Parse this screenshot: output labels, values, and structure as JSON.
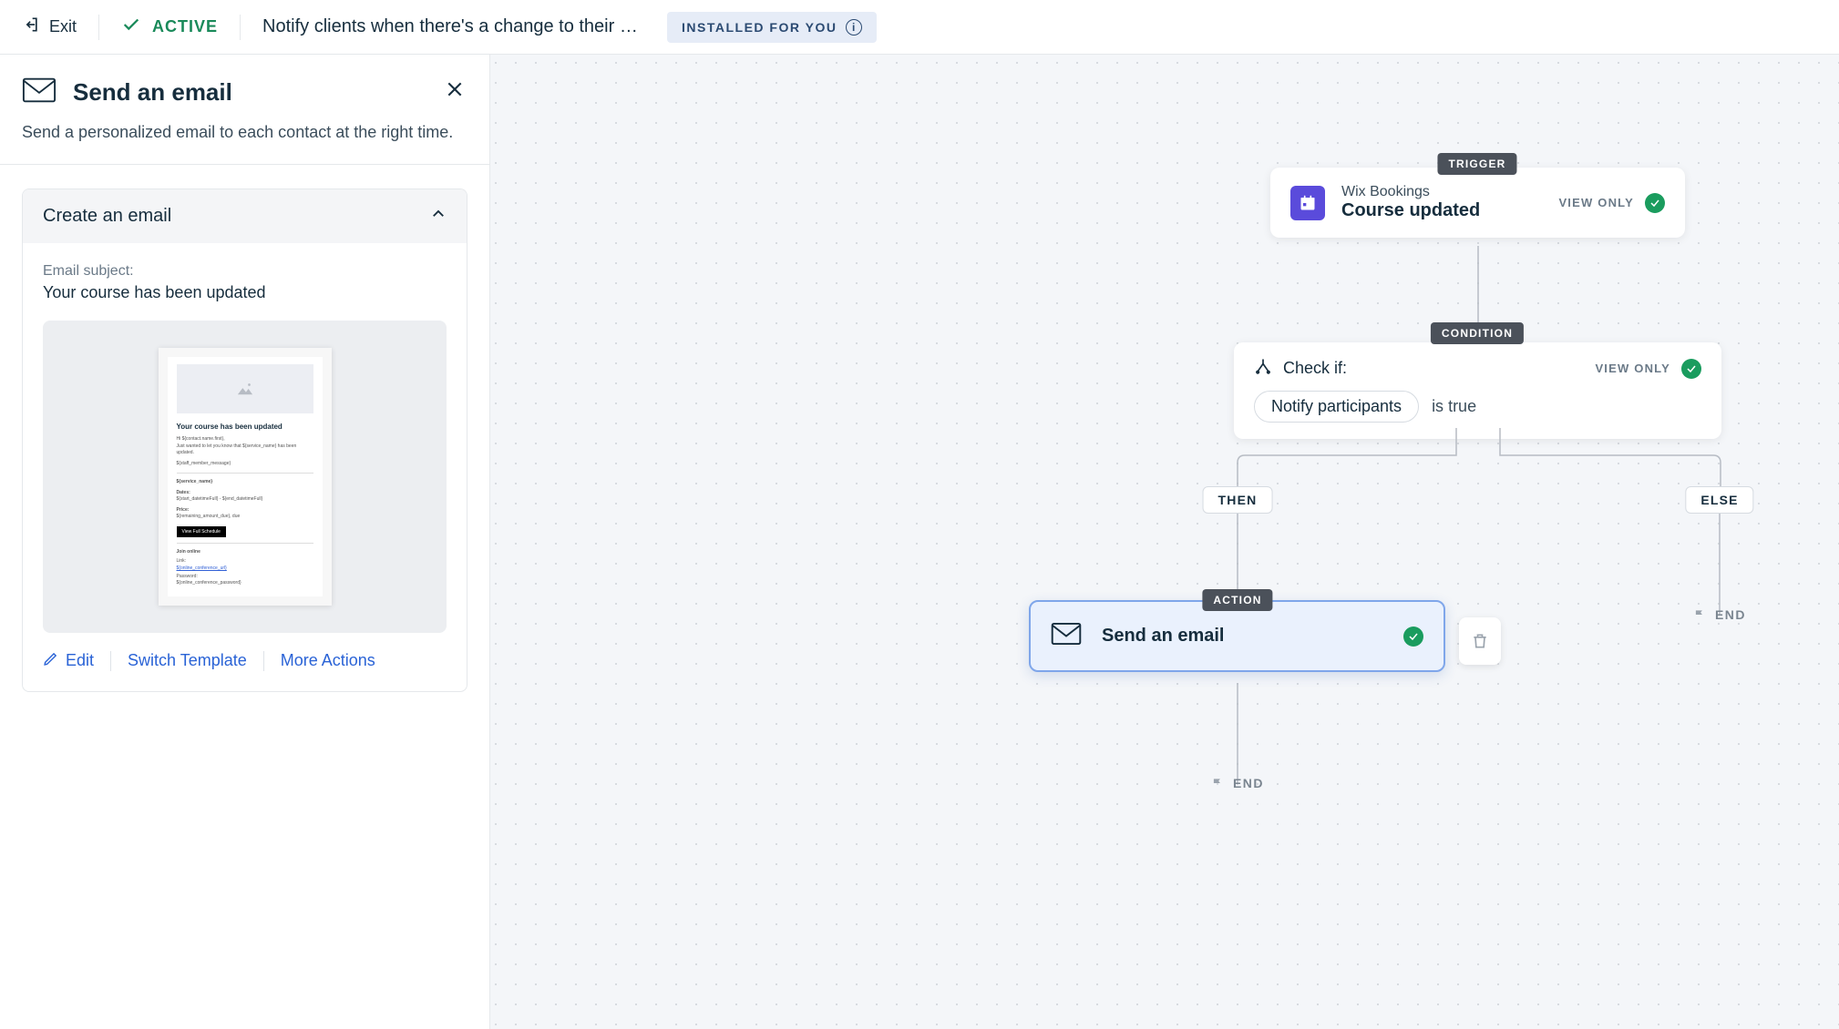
{
  "topbar": {
    "exit": "Exit",
    "status": "ACTIVE",
    "title": "Notify clients when there's a change to their cou…",
    "badge": "INSTALLED FOR YOU"
  },
  "panel": {
    "title": "Send an email",
    "description": "Send a personalized email to each contact at the right time.",
    "accordion_title": "Create an email",
    "subject_label": "Email subject:",
    "subject_value": "Your course has been updated",
    "preview": {
      "title": "Your course has been updated",
      "greeting": "Hi ${contact.name.first},",
      "body1": "Just wanted to let you know that ${service_name} has been updated.",
      "body2": "${staff_member_message}",
      "service": "${service_name}",
      "dates_label": "Dates:",
      "dates_value": "${start_datetimeFull} - ${end_datetimeFull}",
      "price_label": "Price:",
      "price_value": "${remaining_amount_due}, due",
      "button": "View Full Schedule",
      "join_title": "Join online",
      "link_label": "Link:",
      "link_value": "${online_conference_url}",
      "password_label": "Password:",
      "password_value": "${online_conference_password}"
    },
    "actions": {
      "edit": "Edit",
      "switch": "Switch Template",
      "more": "More Actions"
    }
  },
  "canvas": {
    "trigger_label": "TRIGGER",
    "condition_label": "CONDITION",
    "action_label": "ACTION",
    "then_label": "THEN",
    "else_label": "ELSE",
    "end_label": "END",
    "view_only": "VIEW ONLY",
    "trigger": {
      "app": "Wix Bookings",
      "event": "Course updated"
    },
    "condition": {
      "check_if": "Check if:",
      "chip": "Notify participants",
      "suffix": "is true"
    },
    "action": {
      "title": "Send an email"
    }
  }
}
